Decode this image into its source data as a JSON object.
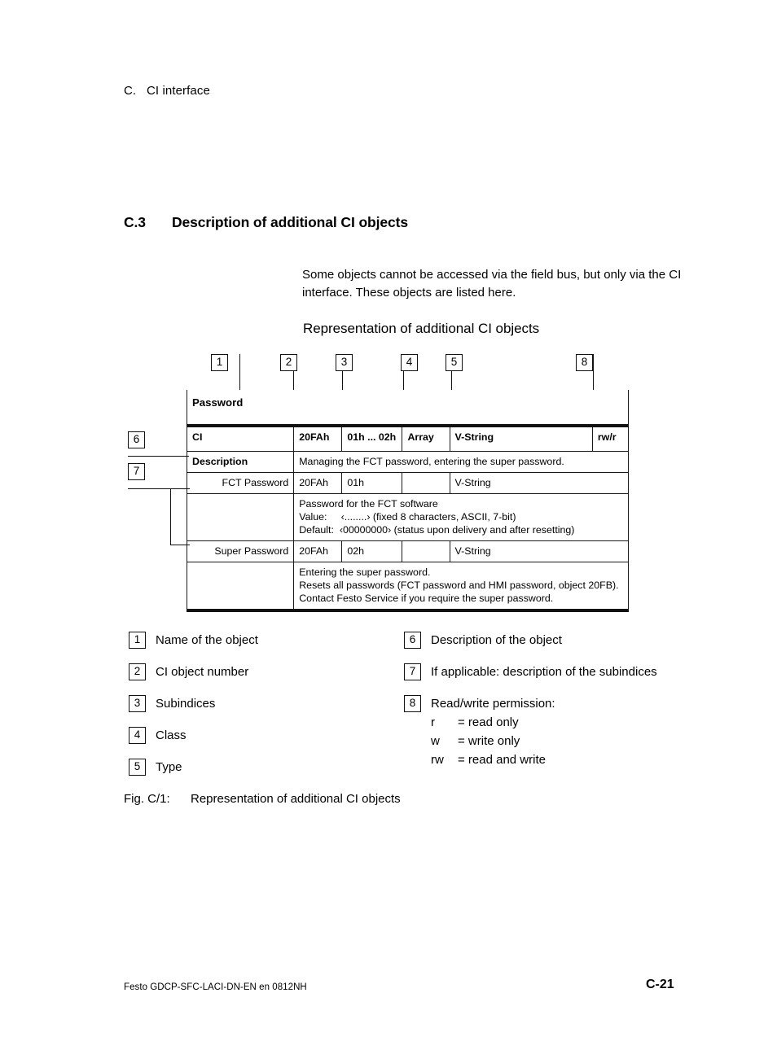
{
  "running_head": {
    "appendix_letter": "C.",
    "title": "CI interface"
  },
  "section": {
    "number": "C.3",
    "title": "Description of additional CI objects"
  },
  "intro_paragraph": "Some objects cannot be accessed via the field bus, but only via the CI interface. These objects are listed here.",
  "figure": {
    "title": "Representation of additional CI objects",
    "caption_label": "Fig. C/1:",
    "caption_text": "Representation of additional CI objects",
    "callouts": [
      "1",
      "2",
      "3",
      "4",
      "5",
      "6",
      "7",
      "8"
    ],
    "table": {
      "object_name": "Password",
      "header_row": {
        "name": "CI",
        "object_number": "20FAh",
        "subindices": "01h ... 02h",
        "class": "Array",
        "type": "V-String",
        "permission": "rw/r"
      },
      "description_row": {
        "label": "Description",
        "text": "Managing the FCT password, entering the super password."
      },
      "subindices": [
        {
          "label": "FCT Password",
          "object_number": "20FAh",
          "subindex": "01h",
          "class": "",
          "type": "V-String",
          "detail_lines": [
            "Password for the FCT software",
            "Value:     ‹........› (fixed 8 characters, ASCII, 7-bit)",
            "Default:  ‹00000000› (status upon delivery and after resetting)"
          ]
        },
        {
          "label": "Super Password",
          "object_number": "20FAh",
          "subindex": "02h",
          "class": "",
          "type": "V-String",
          "detail_lines": [
            "Entering the super password.",
            "Resets all passwords (FCT password and HMI password, object 20FB).",
            "Contact Festo Service if you require the super password."
          ]
        }
      ]
    }
  },
  "legend": {
    "left": [
      {
        "num": "1",
        "text": "Name of the object"
      },
      {
        "num": "2",
        "text": "CI object number"
      },
      {
        "num": "3",
        "text": "Subindices"
      },
      {
        "num": "4",
        "text": "Class"
      },
      {
        "num": "5",
        "text": "Type"
      }
    ],
    "right": [
      {
        "num": "6",
        "text": "Description of the object"
      },
      {
        "num": "7",
        "text": "If applicable: description of the subindices"
      },
      {
        "num": "8",
        "text": "Read/write permission:"
      }
    ],
    "permissions": [
      {
        "key": "r",
        "value": "= read only"
      },
      {
        "key": "w",
        "value": "= write only"
      },
      {
        "key": "rw",
        "value": "= read and write"
      }
    ]
  },
  "footer": {
    "document_id": "Festo GDCP-SFC-LACI-DN-EN  en 0812NH",
    "page_number": "C-21"
  }
}
